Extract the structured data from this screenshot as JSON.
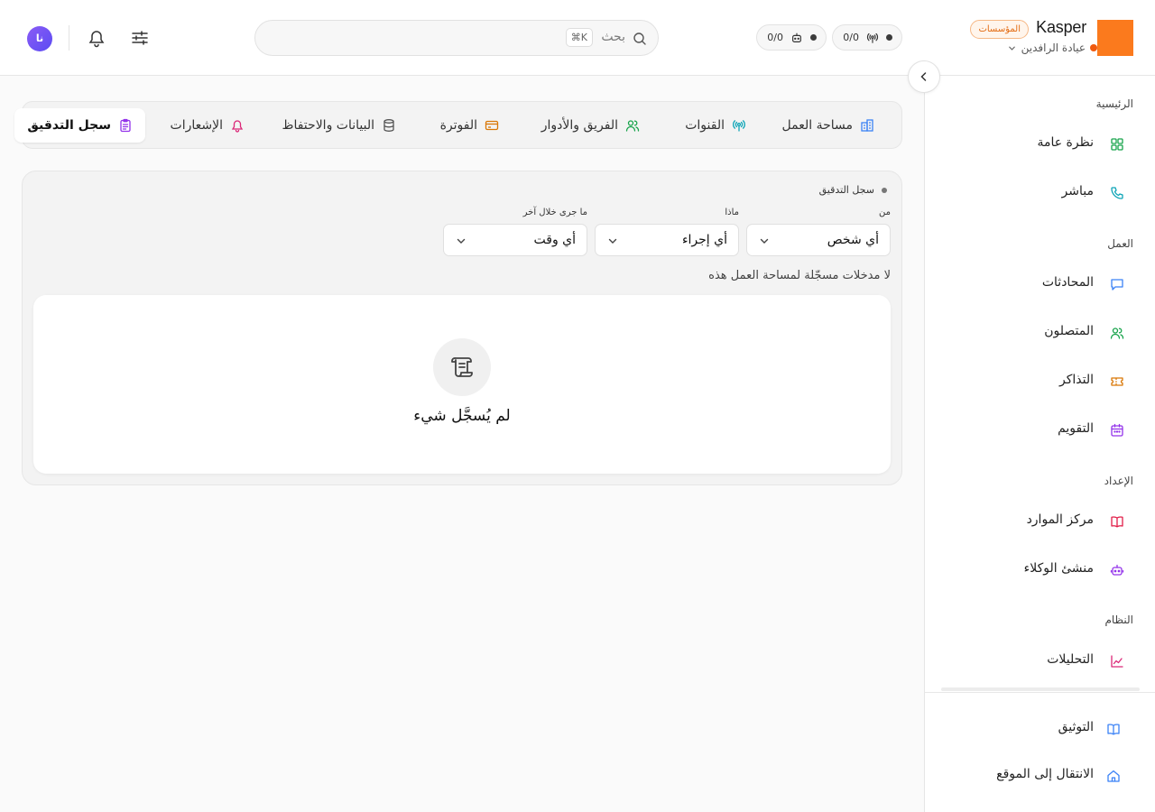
{
  "brand": {
    "name": "Kasper",
    "badge": "المؤسسات",
    "workspace": "عيادة الرافدين",
    "logo_color": "#fb7a1d"
  },
  "header": {
    "channels_count": "0/0",
    "agents_count": "0/0",
    "search_label": "بحث",
    "search_shortcut": "⌘K",
    "avatar_initials": "نا"
  },
  "sidebar": {
    "sections": {
      "main": "الرئيسية",
      "work": "العمل",
      "setup": "الإعداد",
      "system": "النظام"
    },
    "items": {
      "overview": "نظرة عامة",
      "live": "مباشر",
      "conversations": "المحادثات",
      "contacts": "المتصلون",
      "tickets": "التذاكر",
      "calendar": "التقويم",
      "resources": "مركز الموارد",
      "agent_builder": "منشئ الوكلاء",
      "analytics": "التحليلات"
    },
    "bottom": {
      "docs": "التوثيق",
      "go_to_site": "الانتقال إلى الموقع"
    }
  },
  "tabs": {
    "workspace": "مساحة العمل",
    "channels": "القنوات",
    "team": "الفريق والأدوار",
    "billing": "الفوترة",
    "data": "البيانات والاحتفاظ",
    "notifications": "الإشعارات",
    "audit": "سجل التدقيق",
    "active": "audit"
  },
  "audit": {
    "title": "سجل التدقيق",
    "filters": {
      "who_label": "من",
      "who_value": "أي شخص",
      "what_label": "ماذا",
      "what_value": "أي إجراء",
      "when_label": "ما جرى خلال آخر",
      "when_value": "أي وقت"
    },
    "empty_note": "لا مدخلات مسجّلة لمساحة العمل هذه",
    "empty_title": "لم يُسجَّل شيء"
  },
  "colors": {
    "accent_orange": "#f05a0f",
    "icon_blue": "#3b82f6",
    "icon_green": "#16a34a",
    "icon_teal": "#0ea5b7",
    "icon_amber": "#d97706",
    "icon_purple": "#9333ea",
    "icon_red": "#e11d48",
    "icon_pink": "#db2777"
  }
}
